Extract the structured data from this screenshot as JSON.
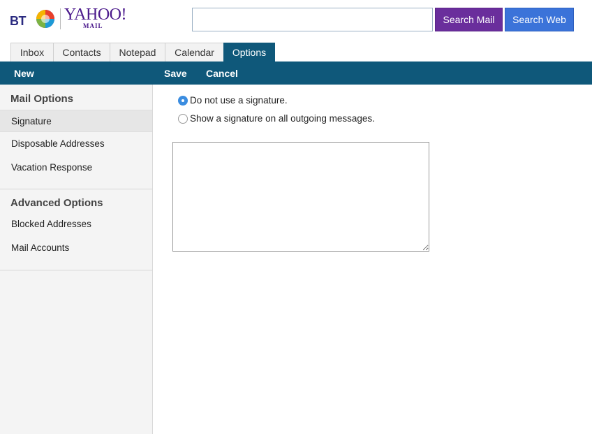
{
  "logo": {
    "bt": "BT",
    "yahoo": "YAHOO!",
    "mail": "MAIL"
  },
  "search": {
    "value": "",
    "placeholder": "",
    "mail_label": "Search Mail",
    "web_label": "Search Web"
  },
  "tabs": [
    {
      "label": "Inbox",
      "active": false
    },
    {
      "label": "Contacts",
      "active": false
    },
    {
      "label": "Notepad",
      "active": false
    },
    {
      "label": "Calendar",
      "active": false
    },
    {
      "label": "Options",
      "active": true
    }
  ],
  "toolbar": {
    "new_label": "New",
    "save_label": "Save",
    "cancel_label": "Cancel"
  },
  "sidebar": {
    "mail_options_heading": "Mail Options",
    "mail_options": [
      "Signature",
      "Disposable Addresses",
      "Vacation Response"
    ],
    "advanced_options_heading": "Advanced Options",
    "advanced_options": [
      "Blocked Addresses",
      "Mail Accounts"
    ],
    "selected": "Signature"
  },
  "signature": {
    "option_none": "Do not use a signature.",
    "option_all": "Show a signature on all outgoing messages.",
    "selected": "none",
    "text": ""
  },
  "colors": {
    "brand_bar": "#0f587a",
    "search_mail": "#6a2e9c",
    "search_web": "#3b73d9"
  }
}
